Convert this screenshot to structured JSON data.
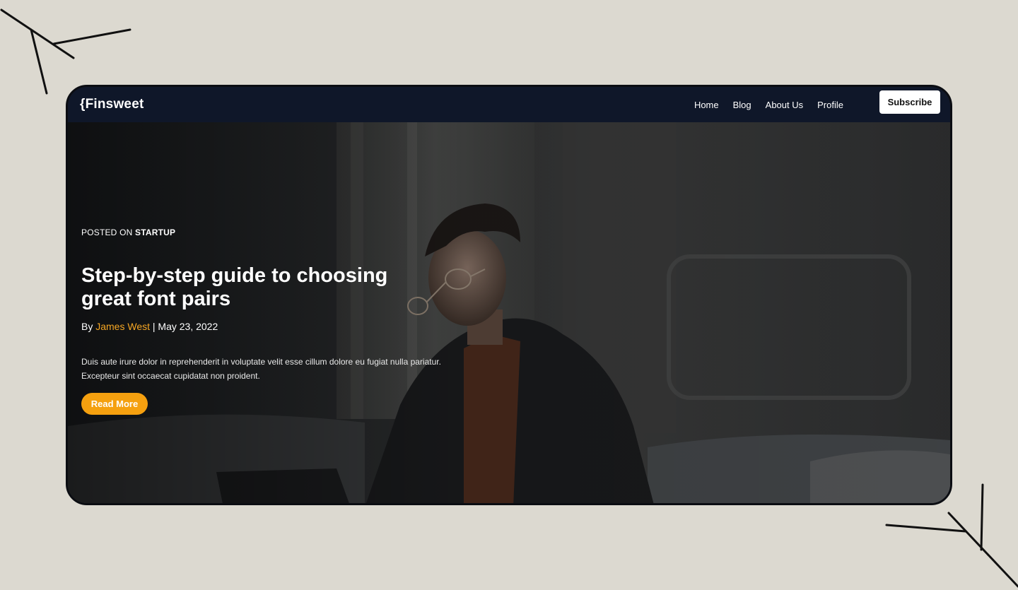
{
  "nav": {
    "brand": "{Finsweet",
    "links": [
      "Home",
      "Blog",
      "About Us",
      "Profile"
    ],
    "subscribe_label": "Subscribe"
  },
  "hero": {
    "posted_prefix": "POSTED ON ",
    "category": "STARTUP",
    "title": "Step-by-step guide to choosing great font pairs",
    "by_prefix": "By ",
    "author": "James West",
    "date_sep": " | May 23, 2022",
    "excerpt": "Duis aute irure dolor in reprehenderit in voluptate velit esse cillum dolore eu fugiat nulla pariatur. Excepteur sint occaecat cupidatat non proident.",
    "cta_label": "Read More"
  },
  "colors": {
    "page_bg": "#dcd9d0",
    "nav_bg": "#0f1729",
    "accent": "#f5a00f",
    "author": "#f5a623"
  }
}
